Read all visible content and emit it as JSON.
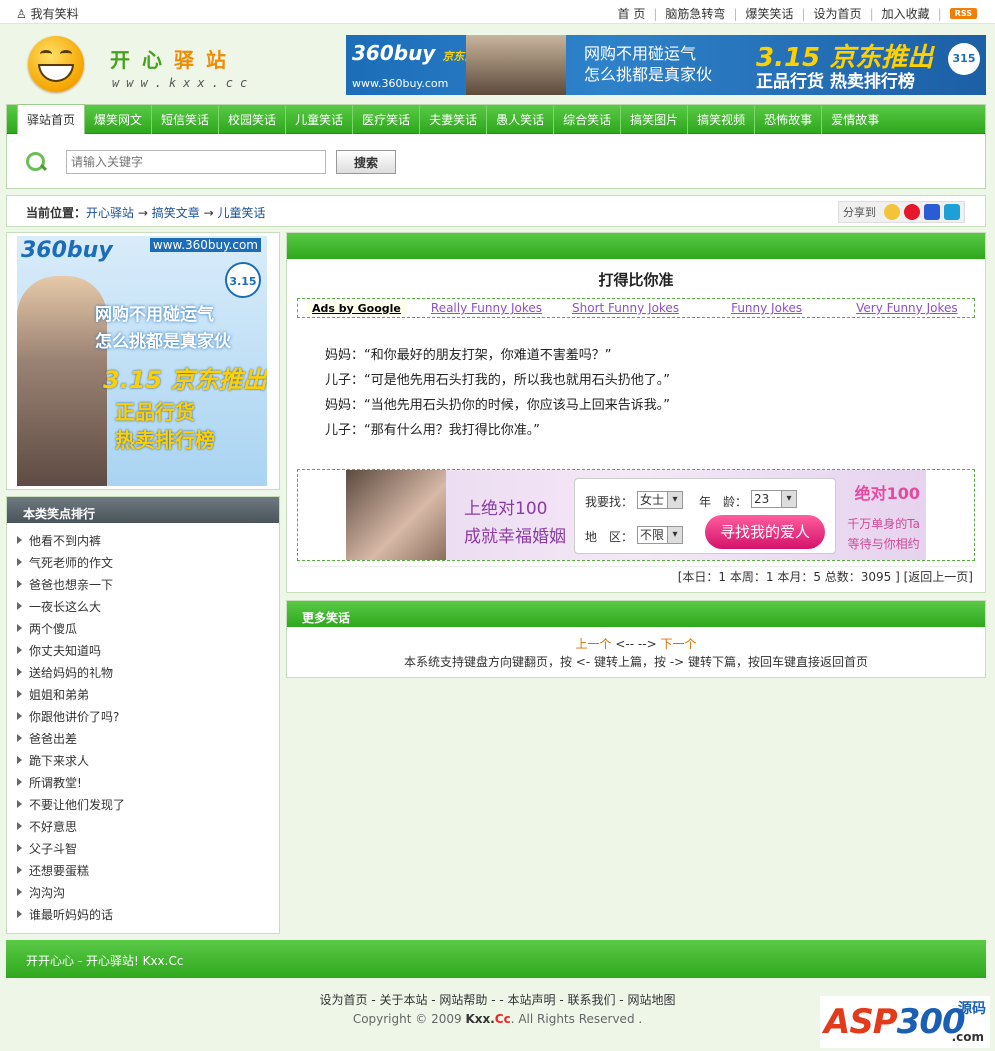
{
  "topbar": {
    "left_label": "我有笑料",
    "links": [
      "首 页",
      "脑筋急转弯",
      "爆笑笑话",
      "设为首页",
      "加入收藏"
    ],
    "rss": "RSS"
  },
  "logo": {
    "title_a": "开心",
    "title_b": "驿站",
    "url": "www.kxx.cc"
  },
  "banner_top": {
    "brand": "360buy",
    "brand_tag": "京东商城",
    "url": "www.360buy.com",
    "slogan_1": "网购不用碰运气",
    "slogan_2": "怎么挑都是真家伙",
    "promo_1": "3.15 京东推出",
    "promo_2": "正品行货 热卖排行榜",
    "badge": "315"
  },
  "nav": {
    "items": [
      "驿站首页",
      "爆笑网文",
      "短信笑话",
      "校园笑话",
      "儿童笑话",
      "医疗笑话",
      "夫妻笑话",
      "愚人笑话",
      "综合笑话",
      "搞笑图片",
      "搞笑视频",
      "恐怖故事",
      "爱情故事"
    ],
    "active_index": 0
  },
  "search": {
    "placeholder": "请输入关键字",
    "button": "搜索"
  },
  "breadcrumb": {
    "label": "当前位置：",
    "items": [
      "开心驿站",
      "搞笑文章",
      "儿童笑话"
    ],
    "arrow": "→",
    "share_label": "分享到"
  },
  "ad_left": {
    "brand": "360buy",
    "url": "www.360buy.com",
    "slogan_1": "网购不用碰运气",
    "slogan_2": "怎么挑都是真家伙",
    "promo_1": "3.15 京东推出",
    "promo_2": "正品行货",
    "promo_3": "热卖排行榜",
    "badge": "3.15"
  },
  "rank": {
    "title": "本类笑点排行",
    "items": [
      "他看不到内裤",
      "气死老师的作文",
      "爸爸也想亲一下",
      "一夜长这么大",
      "两个傻瓜",
      "你丈夫知道吗",
      "送给妈妈的礼物",
      "姐姐和弟弟",
      "你跟他讲价了吗?",
      "爸爸出差",
      "跪下来求人",
      "所谓教堂!",
      "不要让他们发现了",
      "不好意思",
      "父子斗智",
      "还想要蛋糕",
      "沟沟沟",
      "谁最听妈妈的话"
    ]
  },
  "article": {
    "title": "打得比你准",
    "ads_by_google": "Ads by Google",
    "ad_links": [
      "Really Funny Jokes",
      "Short Funny Jokes",
      "Funny Jokes",
      "Very Funny Jokes"
    ],
    "lines": [
      "妈妈：“和你最好的朋友打架，你难道不害羞吗？”",
      "儿子：“可是他先用石头打我的，所以我也就用石头扔他了。”",
      "妈妈：“当他先用石头扔你的时候，你应该马上回来告诉我。”",
      "儿子：“那有什么用？我打得比你准。”"
    ],
    "stats": "[本日：1 本周：1 本月：5 总数：3095 ] [返回上一页]"
  },
  "dating_ad": {
    "line_1": "上绝对100",
    "line_2": "成就幸福婚姻",
    "find_label": "我要找：",
    "find_value": "女士",
    "age_label": "年　龄：",
    "age_value": "23",
    "area_label": "地　区：",
    "area_value": "不限",
    "button": "寻找我的爱人",
    "logo": "绝对100",
    "tag_1": "千万单身的Ta",
    "tag_2": "等待与你相约"
  },
  "more": {
    "title": "更多笑话",
    "prev": "上一个",
    "middle": " <-- --> ",
    "next": "下一个",
    "hint": "本系统支持键盘方向键翻页，按 <- 键转上篇，按 -> 键转下篇，按回车键直接返回首页"
  },
  "footer": {
    "tagline": "开开心心 - 开心驿站! Kxx.Cc",
    "links": "设为首页 - 关于本站 - 网站帮助 - - 本站声明 - 联系我们 - 网站地图",
    "copyright_prefix": "Copyright © 2009",
    "copyright_site_a": "Kxx.",
    "copyright_site_b": "Cc",
    "copyright_suffix": ". All Rights Reserved .",
    "watermark_a": "ASP",
    "watermark_b": "300",
    "watermark_c": "源码",
    "watermark_d": ".com"
  }
}
